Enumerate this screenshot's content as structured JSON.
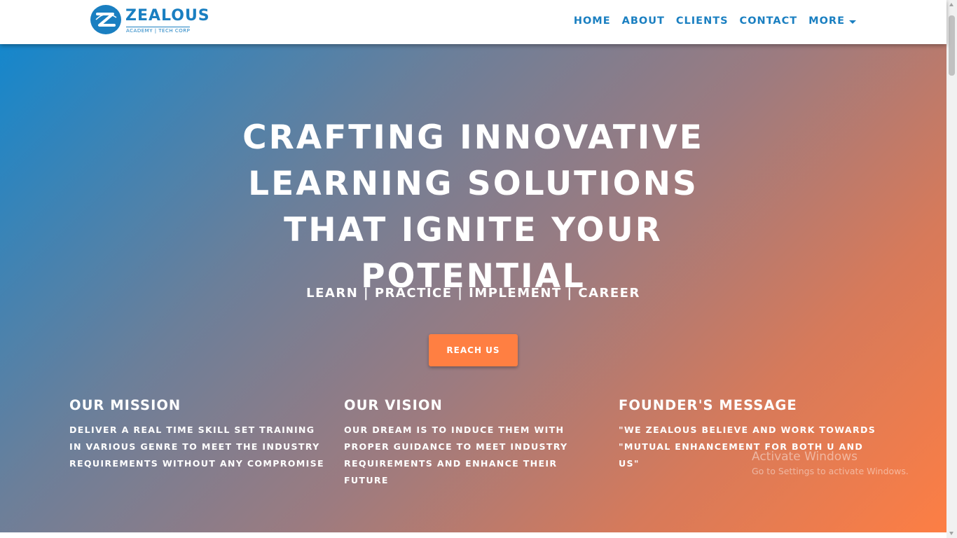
{
  "brand": {
    "name": "ZEALOUS",
    "tagline": "ACADEMY | TECH CORP",
    "color": "#1a7fc1"
  },
  "nav": {
    "items": [
      "HOME",
      "ABOUT",
      "CLIENTS",
      "CONTACT"
    ],
    "more_label": "MORE",
    "more_icon": "caret-down-icon"
  },
  "hero": {
    "headline": "CRAFTING INNOVATIVE LEARNING SOLUTIONS THAT IGNITE YOUR POTENTIAL",
    "tagline": "LEARN | PRACTICE | IMPLEMENT | CAREER",
    "cta_label": "REACH US",
    "gradient_start": "#1587cc",
    "gradient_end": "#fd7e44",
    "cta_color": "#ff7f42"
  },
  "sections": [
    {
      "title": "OUR MISSION",
      "body": "DELIVER A REAL TIME SKILL SET TRAINING IN VARIOUS GENRE TO MEET THE INDUSTRY REQUIREMENTS WITHOUT ANY COMPROMISE"
    },
    {
      "title": "OUR VISION",
      "body": "OUR DREAM IS TO INDUCE THEM WITH PROPER GUIDANCE TO MEET INDUSTRY REQUIREMENTS AND ENHANCE THEIR FUTURE"
    },
    {
      "title": "FOUNDER'S MESSAGE",
      "body": "\"WE ZEALOUS BELIEVE AND WORK TOWARDS \"MUTUAL ENHANCEMENT FOR BOTH U AND US\""
    }
  ],
  "watermark": {
    "title": "Activate Windows",
    "subtitle": "Go to Settings to activate Windows."
  }
}
